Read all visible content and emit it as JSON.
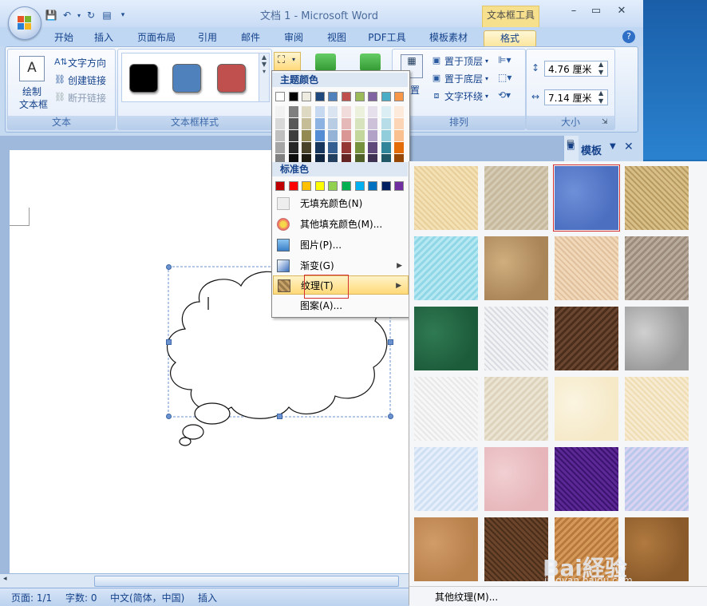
{
  "title_bar": {
    "doc_title": "文档 1 - Microsoft Word",
    "context_tab_title": "文本框工具"
  },
  "window_buttons": {
    "minimize": "–",
    "maximize": "▭",
    "close": "✕"
  },
  "tabs": [
    "开始",
    "插入",
    "页面布局",
    "引用",
    "邮件",
    "审阅",
    "视图",
    "PDF工具",
    "模板素材",
    "格式"
  ],
  "active_tab": "格式",
  "ribbon": {
    "text_group": {
      "label": "文本",
      "draw_textbox": "绘制",
      "draw_textbox_2": "文本框",
      "text_direction": "文字方向",
      "create_link": "创建链接",
      "break_link": "断开链接"
    },
    "textbox_styles_group": {
      "label": "文本框样式",
      "swatches": [
        "#000000",
        "#4f81bd",
        "#c0504d"
      ]
    },
    "arrange_group": {
      "label": "排列",
      "bring_front": "置于顶层",
      "send_back": "置于底层",
      "wrap": "文字环绕",
      "position_partial": "置"
    },
    "size_group": {
      "label": "大小",
      "height": "4.76 厘米",
      "width": "7.14 厘米"
    }
  },
  "color_menu": {
    "theme_colors_label": "主题颜色",
    "standard_colors_label": "标准色",
    "theme_top_row": [
      "#ffffff",
      "#000000",
      "#eeece1",
      "#1f497d",
      "#4f81bd",
      "#c0504d",
      "#9bbb59",
      "#8064a2",
      "#4bacc6",
      "#f79646"
    ],
    "theme_shades": [
      [
        "#f2f2f2",
        "#7f7f7f",
        "#ddd9c3",
        "#c6d9f0",
        "#dbe5f1",
        "#f2dcdb",
        "#ebf1dd",
        "#e5e0ec",
        "#dbeef3",
        "#fdeada"
      ],
      [
        "#d8d8d8",
        "#595959",
        "#c4bd97",
        "#8db3e2",
        "#b8cce4",
        "#e5b9b7",
        "#d7e3bc",
        "#ccc1d9",
        "#b7dde8",
        "#fbd5b5"
      ],
      [
        "#bfbfbf",
        "#3f3f3f",
        "#938953",
        "#548dd4",
        "#95b3d7",
        "#d99694",
        "#c3d69b",
        "#b2a2c7",
        "#92cddc",
        "#fac08f"
      ],
      [
        "#a5a5a5",
        "#262626",
        "#494429",
        "#17365d",
        "#366092",
        "#953734",
        "#76923c",
        "#5f497a",
        "#31859b",
        "#e36c09"
      ],
      [
        "#7f7f7f",
        "#0c0c0c",
        "#1d1b10",
        "#0f243e",
        "#244061",
        "#632423",
        "#4f6128",
        "#3f3151",
        "#205867",
        "#974806"
      ]
    ],
    "standard": [
      "#c00000",
      "#ff0000",
      "#ffc000",
      "#ffff00",
      "#92d050",
      "#00b050",
      "#00b0f0",
      "#0070c0",
      "#002060",
      "#7030a0"
    ],
    "items": [
      {
        "label": "无填充颜色(N)",
        "icon": "no-fill-icon"
      },
      {
        "label": "其他填充颜色(M)...",
        "icon": "palette-icon"
      },
      {
        "label": "图片(P)...",
        "icon": "picture-icon"
      },
      {
        "label": "渐变(G)",
        "icon": "gradient-icon"
      },
      {
        "label": "纹理(T)",
        "icon": "texture-icon"
      },
      {
        "label": "图案(A)...",
        "icon": "pattern-icon"
      }
    ]
  },
  "texture_panel": {
    "more_label": "其他纹理(M)...",
    "textures": [
      {
        "name": "papyrus",
        "c1": "#e8cf9a",
        "c2": "#f3e0b4"
      },
      {
        "name": "canvas",
        "c1": "#d6cbb5",
        "c2": "#c7b99d"
      },
      {
        "name": "denim",
        "c1": "#4c6fc0",
        "c2": "#6e8fd8"
      },
      {
        "name": "woven-mat",
        "c1": "#b89b61",
        "c2": "#d8bf87"
      },
      {
        "name": "water-droplets",
        "c1": "#8fd6e6",
        "c2": "#b6e8f2"
      },
      {
        "name": "paper-bag",
        "c1": "#a98558",
        "c2": "#d0ae7d"
      },
      {
        "name": "fish-fossil",
        "c1": "#e1c09d",
        "c2": "#f0d8b9"
      },
      {
        "name": "sand",
        "c1": "#9a8b7c",
        "c2": "#b9ab9b"
      },
      {
        "name": "green-marble",
        "c1": "#1d5c3b",
        "c2": "#2f7a52"
      },
      {
        "name": "white-marble",
        "c1": "#d8dbe0",
        "c2": "#f2f3f5"
      },
      {
        "name": "brown-marble",
        "c1": "#4a2e1b",
        "c2": "#6a4630"
      },
      {
        "name": "granite",
        "c1": "#9a9a9a",
        "c2": "#d0d0d0"
      },
      {
        "name": "newsprint",
        "c1": "#e8e8e8",
        "c2": "#f7f7f7"
      },
      {
        "name": "recycled-paper",
        "c1": "#ddd3bd",
        "c2": "#ebe4d2"
      },
      {
        "name": "parchment",
        "c1": "#f5e9c8",
        "c2": "#fbf4e0"
      },
      {
        "name": "stationery",
        "c1": "#efdcb2",
        "c2": "#f6ead0"
      },
      {
        "name": "blue-tissue",
        "c1": "#cfe0f3",
        "c2": "#e5eefa"
      },
      {
        "name": "pink-tissue",
        "c1": "#e6b6ba",
        "c2": "#f1cfd2"
      },
      {
        "name": "purple-mesh",
        "c1": "#3c1470",
        "c2": "#5b2896"
      },
      {
        "name": "bouquet",
        "c1": "#b8c8ea",
        "c2": "#d9d2f0"
      },
      {
        "name": "cork",
        "c1": "#b8804b",
        "c2": "#d19c68"
      },
      {
        "name": "walnut",
        "c1": "#4a2e1c",
        "c2": "#6b442a"
      },
      {
        "name": "oak",
        "c1": "#b87a3c",
        "c2": "#d59a5a"
      },
      {
        "name": "medium-wood",
        "c1": "#8a5a2a",
        "c2": "#b07a40"
      }
    ],
    "selected_index": 2
  },
  "templates_pane": {
    "title": "模板"
  },
  "status_bar": {
    "page": "页面: 1/1",
    "words": "字数: 0",
    "language": "中文(简体，中国)",
    "mode": "插入"
  },
  "watermark": {
    "main": "Bai経验",
    "sub": "jingyan.baidu.com"
  }
}
